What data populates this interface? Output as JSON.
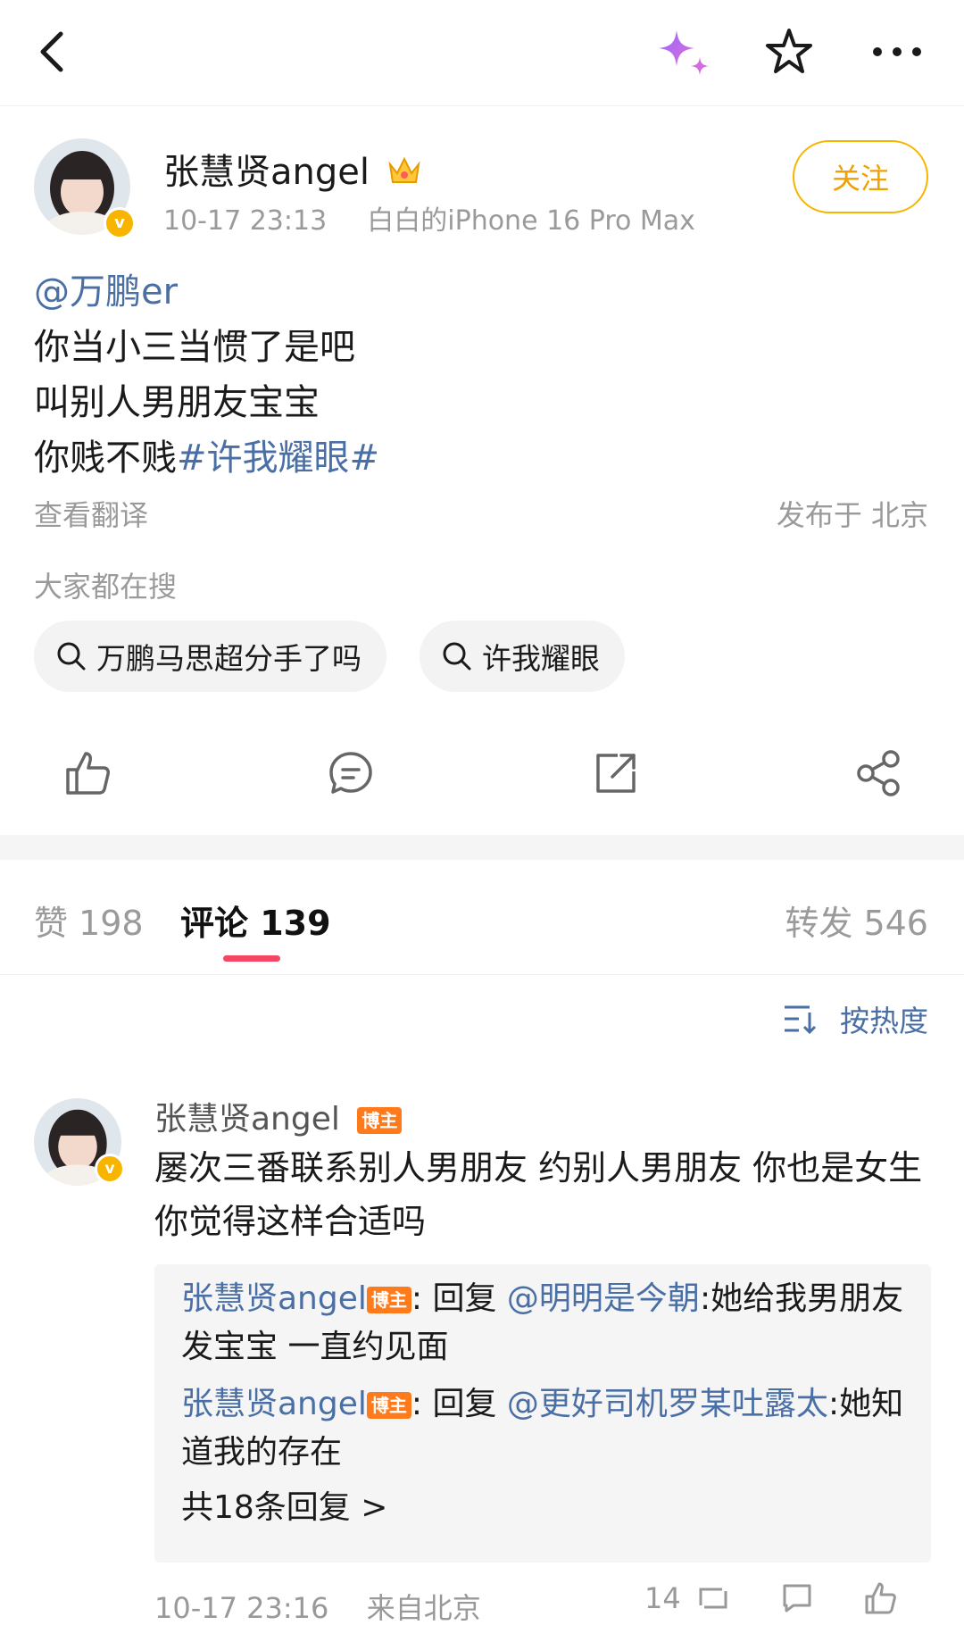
{
  "nav": {
    "back_icon": "chevron-left-icon",
    "ai_icon": "sparkle-icon",
    "star_icon": "star-icon",
    "more_icon": "more-dots-icon"
  },
  "post": {
    "author": "张慧贤angel",
    "crown_icon": "crown-icon",
    "verified_badge": "v",
    "time": "10-17 23:13",
    "device": "白白的iPhone 16 Pro Max",
    "follow_label": "关注",
    "mention": "@万鹏er",
    "lines": [
      "你当小三当惯了是吧",
      "叫别人男朋友宝宝",
      "你贱不贱"
    ],
    "hashtag": "#许我耀眼#",
    "translate": "查看翻译",
    "location": "发布于 北京",
    "trending_title": "大家都在搜",
    "trending": [
      "万鹏马思超分手了吗",
      "许我耀眼"
    ]
  },
  "actions": {
    "like_icon": "thumbs-up-icon",
    "comment_icon": "comment-icon",
    "repost_icon": "repost-icon",
    "share_icon": "share-icon"
  },
  "tabs": {
    "likes": "赞 198",
    "comments": "评论 139",
    "reposts": "转发 546"
  },
  "sort": {
    "label": "按热度",
    "icon": "sort-icon"
  },
  "comment": {
    "author": "张慧贤angel",
    "tag": "博主",
    "text": "屡次三番联系别人男朋友 约别人男朋友 你也是女生 你觉得这样合适吗",
    "replies": [
      {
        "author": "张慧贤angel",
        "tag": "博主",
        "reply_word": ": 回复 ",
        "target": "@明明是今朝",
        "text": ":她给我男朋友发宝宝 一直约见面"
      },
      {
        "author": "张慧贤angel",
        "tag": "博主",
        "reply_word": ": 回复 ",
        "target": "@更好司机罗某吐露太",
        "text": ":她知道我的存在"
      }
    ],
    "more_replies": "共18条回复 >",
    "time": "10-17 23:16",
    "from": "来自北京",
    "like_count": "14"
  },
  "colors": {
    "link": "#4a6fa5",
    "accent": "#f7b500",
    "tab_underline": "#f34763",
    "blogger_tag": "#ff7a1a"
  }
}
